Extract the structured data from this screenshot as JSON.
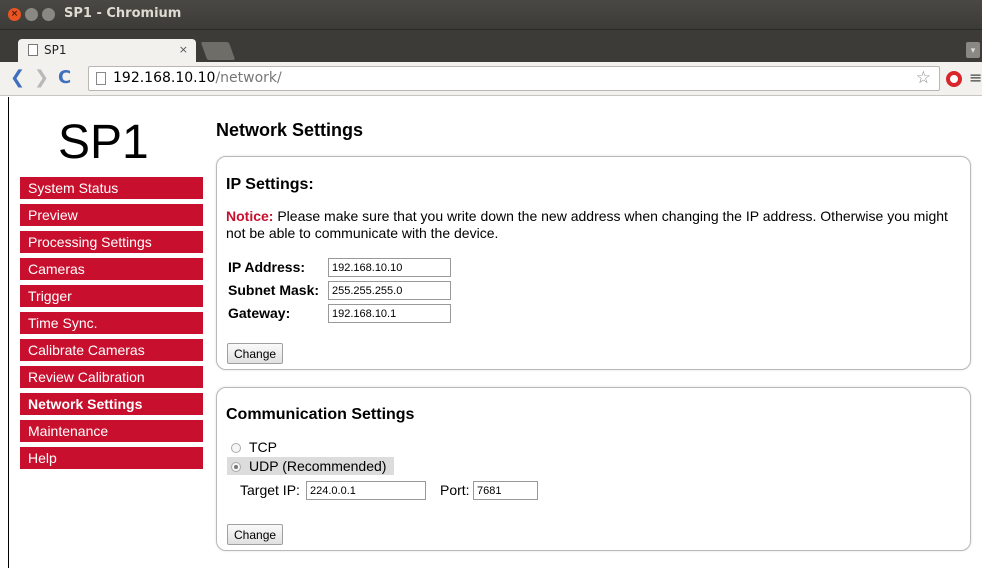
{
  "window": {
    "title": "SP1 - Chromium",
    "close_glyph": "×",
    "min_glyph": "–",
    "max_glyph": "□"
  },
  "tab": {
    "title": "SP1",
    "close_glyph": "×",
    "icon": "page-icon"
  },
  "toolbar": {
    "back_glyph": "❮",
    "forward_glyph": "❯",
    "reload_glyph": "C",
    "url_host": "192.168.10.10",
    "url_path": "/network/",
    "star_glyph": "☆",
    "menu_glyph": "≡"
  },
  "page": {
    "logo": "SP1",
    "title": "Network Settings"
  },
  "sidebar": {
    "accent_color": "#c8102e",
    "items": [
      {
        "label": "System Status",
        "active": false
      },
      {
        "label": "Preview",
        "active": false
      },
      {
        "label": "Processing Settings",
        "active": false
      },
      {
        "label": "Cameras",
        "active": false
      },
      {
        "label": "Trigger",
        "active": false
      },
      {
        "label": "Time Sync.",
        "active": false
      },
      {
        "label": "Calibrate Cameras",
        "active": false
      },
      {
        "label": "Review Calibration",
        "active": false
      },
      {
        "label": "Network Settings",
        "active": true
      },
      {
        "label": "Maintenance",
        "active": false
      },
      {
        "label": "Help",
        "active": false
      }
    ]
  },
  "ip_settings": {
    "heading": "IP Settings:",
    "notice_label": "Notice:",
    "notice_text": " Please make sure that you write down the new address when changing the IP address. Otherwise you might not be able to communicate with the device.",
    "ip_label": "IP Address:",
    "ip_value": "192.168.10.10",
    "subnet_label": "Subnet Mask:",
    "subnet_value": "255.255.255.0",
    "gateway_label": "Gateway:",
    "gateway_value": "192.168.10.1",
    "button": "Change"
  },
  "comm_settings": {
    "heading": "Communication Settings",
    "tcp_label": "TCP",
    "udp_label": "UDP (Recommended)",
    "selected": "UDP",
    "target_ip_label": "Target IP:",
    "target_ip_value": "224.0.0.1",
    "port_label": "Port:",
    "port_value": "7681",
    "button": "Change"
  }
}
